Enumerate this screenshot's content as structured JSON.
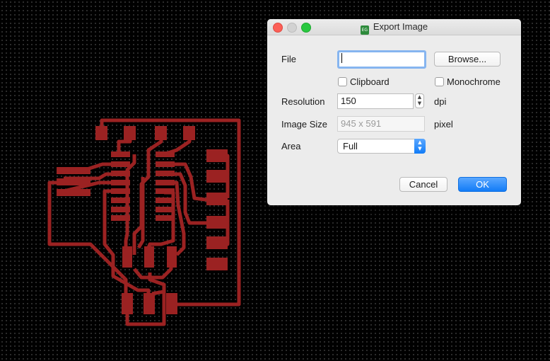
{
  "window": {
    "title": "Export Image",
    "app_icon_text": "EG"
  },
  "form": {
    "file_label": "File",
    "file_value": "",
    "browse_label": "Browse...",
    "clipboard_label": "Clipboard",
    "clipboard_checked": false,
    "monochrome_label": "Monochrome",
    "monochrome_checked": false,
    "resolution_label": "Resolution",
    "resolution_value": "150",
    "resolution_unit": "dpi",
    "image_size_label": "Image Size",
    "image_size_value": "945 x 591",
    "image_size_unit": "pixel",
    "area_label": "Area",
    "area_value": "Full"
  },
  "buttons": {
    "cancel_label": "Cancel",
    "ok_label": "OK"
  },
  "colors": {
    "trace": "#9b2222",
    "background": "#000000",
    "accent": "#127cf7"
  }
}
